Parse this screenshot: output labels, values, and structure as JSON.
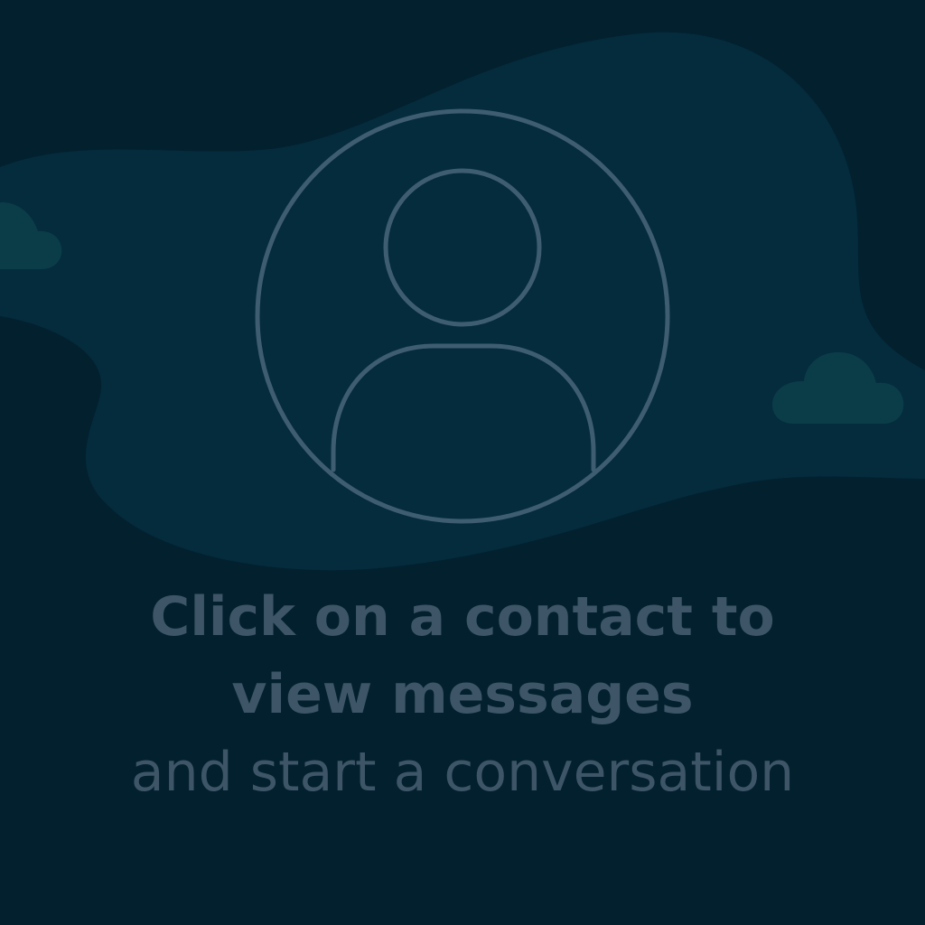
{
  "empty_state": {
    "line1": "Click on a contact to",
    "line2": "view messages",
    "line3": "and start a conversation"
  },
  "colors": {
    "background": "#03202e",
    "blob": "#042c3d",
    "cloud": "#0b3d49",
    "icon_stroke": "#3f5d70",
    "text": "#3d5567"
  },
  "icons": {
    "avatar": "user-circle-icon",
    "cloud_left": "cloud-icon",
    "cloud_right": "cloud-icon"
  }
}
